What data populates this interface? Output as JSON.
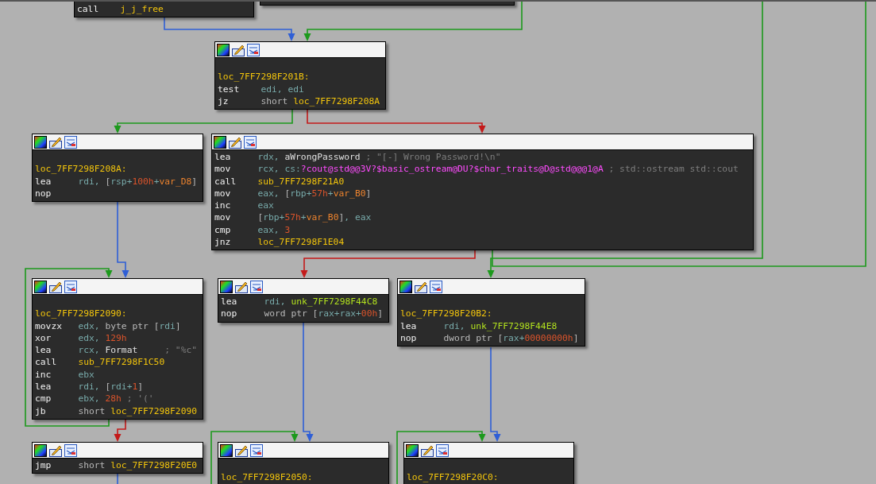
{
  "graph": {
    "nodes": [
      {
        "instructions": [
          {
            "mnemonic": "call",
            "operands": [
              {
                "kind": "code",
                "t": "j_j_free"
              }
            ]
          }
        ]
      },
      {
        "label": "loc_7FF7298F201B:",
        "instructions": [
          {
            "mnemonic": "test",
            "operands": [
              {
                "kind": "reg",
                "t": "edi, edi"
              }
            ]
          },
          {
            "mnemonic": "jz",
            "operands": [
              {
                "kind": "kw",
                "t": "short "
              },
              {
                "kind": "code",
                "t": "loc_7FF7298F208A"
              }
            ]
          }
        ]
      },
      {
        "label": "loc_7FF7298F208A:",
        "instructions": [
          {
            "mnemonic": "lea",
            "operands": [
              {
                "kind": "reg",
                "t": "rdi, "
              },
              {
                "kind": "kw",
                "t": "["
              },
              {
                "kind": "reg",
                "t": "rsp+"
              },
              {
                "kind": "num",
                "t": "100h"
              },
              {
                "kind": "reg",
                "t": "+"
              },
              {
                "kind": "var",
                "t": "var_D8"
              },
              {
                "kind": "kw",
                "t": "]"
              }
            ]
          },
          {
            "mnemonic": "nop"
          }
        ]
      },
      {
        "instructions": [
          {
            "mnemonic": "lea",
            "operands": [
              {
                "kind": "reg",
                "t": "rdx, "
              },
              {
                "kind": "name",
                "t": "aWrongPassword"
              },
              {
                "kind": "cmt",
                "t": " ; \"[-] Wrong Password!\\n\""
              }
            ]
          },
          {
            "mnemonic": "mov",
            "operands": [
              {
                "kind": "reg",
                "t": "rcx, cs:"
              },
              {
                "kind": "imp",
                "t": "?cout@std@@3V?$basic_ostream@DU?$char_traits@D@std@@@1@A"
              },
              {
                "kind": "cmt",
                "t": " ; std::ostream std::cout"
              }
            ]
          },
          {
            "mnemonic": "call",
            "operands": [
              {
                "kind": "code",
                "t": "sub_7FF7298F21A0"
              }
            ]
          },
          {
            "mnemonic": "mov",
            "operands": [
              {
                "kind": "reg",
                "t": "eax, "
              },
              {
                "kind": "kw",
                "t": "["
              },
              {
                "kind": "reg",
                "t": "rbp+"
              },
              {
                "kind": "num",
                "t": "57h"
              },
              {
                "kind": "reg",
                "t": "+"
              },
              {
                "kind": "var",
                "t": "var_B0"
              },
              {
                "kind": "kw",
                "t": "]"
              }
            ]
          },
          {
            "mnemonic": "inc",
            "operands": [
              {
                "kind": "reg",
                "t": "eax"
              }
            ]
          },
          {
            "mnemonic": "mov",
            "operands": [
              {
                "kind": "kw",
                "t": "["
              },
              {
                "kind": "reg",
                "t": "rbp+"
              },
              {
                "kind": "num",
                "t": "57h"
              },
              {
                "kind": "reg",
                "t": "+"
              },
              {
                "kind": "var",
                "t": "var_B0"
              },
              {
                "kind": "kw",
                "t": "]"
              },
              {
                "kind": "reg",
                "t": ", eax"
              }
            ]
          },
          {
            "mnemonic": "cmp",
            "operands": [
              {
                "kind": "reg",
                "t": "eax, "
              },
              {
                "kind": "num",
                "t": "3"
              }
            ]
          },
          {
            "mnemonic": "jnz",
            "operands": [
              {
                "kind": "code",
                "t": "loc_7FF7298F1E04"
              }
            ]
          }
        ]
      },
      {
        "label": "loc_7FF7298F2090:",
        "instructions": [
          {
            "mnemonic": "movzx",
            "operands": [
              {
                "kind": "reg",
                "t": "edx, "
              },
              {
                "kind": "kw",
                "t": "byte ptr ["
              },
              {
                "kind": "reg",
                "t": "rdi"
              },
              {
                "kind": "kw",
                "t": "]"
              }
            ]
          },
          {
            "mnemonic": "xor",
            "operands": [
              {
                "kind": "reg",
                "t": "edx, "
              },
              {
                "kind": "num",
                "t": "129h"
              }
            ]
          },
          {
            "mnemonic": "lea",
            "operands": [
              {
                "kind": "reg",
                "t": "rcx, "
              },
              {
                "kind": "name",
                "t": "Format"
              },
              {
                "kind": "cmt",
                "t": "     ; \"%c\""
              }
            ]
          },
          {
            "mnemonic": "call",
            "operands": [
              {
                "kind": "code",
                "t": "sub_7FF7298F1C50"
              }
            ]
          },
          {
            "mnemonic": "inc",
            "operands": [
              {
                "kind": "reg",
                "t": "ebx"
              }
            ]
          },
          {
            "mnemonic": "lea",
            "operands": [
              {
                "kind": "reg",
                "t": "rdi, "
              },
              {
                "kind": "kw",
                "t": "["
              },
              {
                "kind": "reg",
                "t": "rdi+"
              },
              {
                "kind": "num",
                "t": "1"
              },
              {
                "kind": "kw",
                "t": "]"
              }
            ]
          },
          {
            "mnemonic": "cmp",
            "operands": [
              {
                "kind": "reg",
                "t": "ebx, "
              },
              {
                "kind": "num",
                "t": "28h"
              },
              {
                "kind": "cmt",
                "t": " ; '('"
              }
            ]
          },
          {
            "mnemonic": "jb",
            "operands": [
              {
                "kind": "kw",
                "t": "short "
              },
              {
                "kind": "code",
                "t": "loc_7FF7298F2090"
              }
            ]
          }
        ]
      },
      {
        "instructions": [
          {
            "mnemonic": "lea",
            "operands": [
              {
                "kind": "reg",
                "t": "rdi, "
              },
              {
                "kind": "data",
                "t": "unk_7FF7298F44C8"
              }
            ]
          },
          {
            "mnemonic": "nop",
            "operands": [
              {
                "kind": "kw",
                "t": "word ptr ["
              },
              {
                "kind": "reg",
                "t": "rax+rax+"
              },
              {
                "kind": "num",
                "t": "00h"
              },
              {
                "kind": "kw",
                "t": "]"
              }
            ]
          }
        ]
      },
      {
        "label": "loc_7FF7298F20B2:",
        "instructions": [
          {
            "mnemonic": "lea",
            "operands": [
              {
                "kind": "reg",
                "t": "rdi, "
              },
              {
                "kind": "data",
                "t": "unk_7FF7298F44E8"
              }
            ]
          },
          {
            "mnemonic": "nop",
            "operands": [
              {
                "kind": "kw",
                "t": "dword ptr ["
              },
              {
                "kind": "reg",
                "t": "rax+"
              },
              {
                "kind": "num",
                "t": "00000000h"
              },
              {
                "kind": "kw",
                "t": "]"
              }
            ]
          }
        ]
      },
      {
        "instructions": [
          {
            "mnemonic": "jmp",
            "operands": [
              {
                "kind": "kw",
                "t": "short "
              },
              {
                "kind": "code",
                "t": "loc_7FF7298F20E0"
              }
            ]
          }
        ]
      },
      {
        "label": "loc_7FF7298F2050:"
      },
      {
        "label": "loc_7FF7298F20C0:"
      }
    ]
  }
}
